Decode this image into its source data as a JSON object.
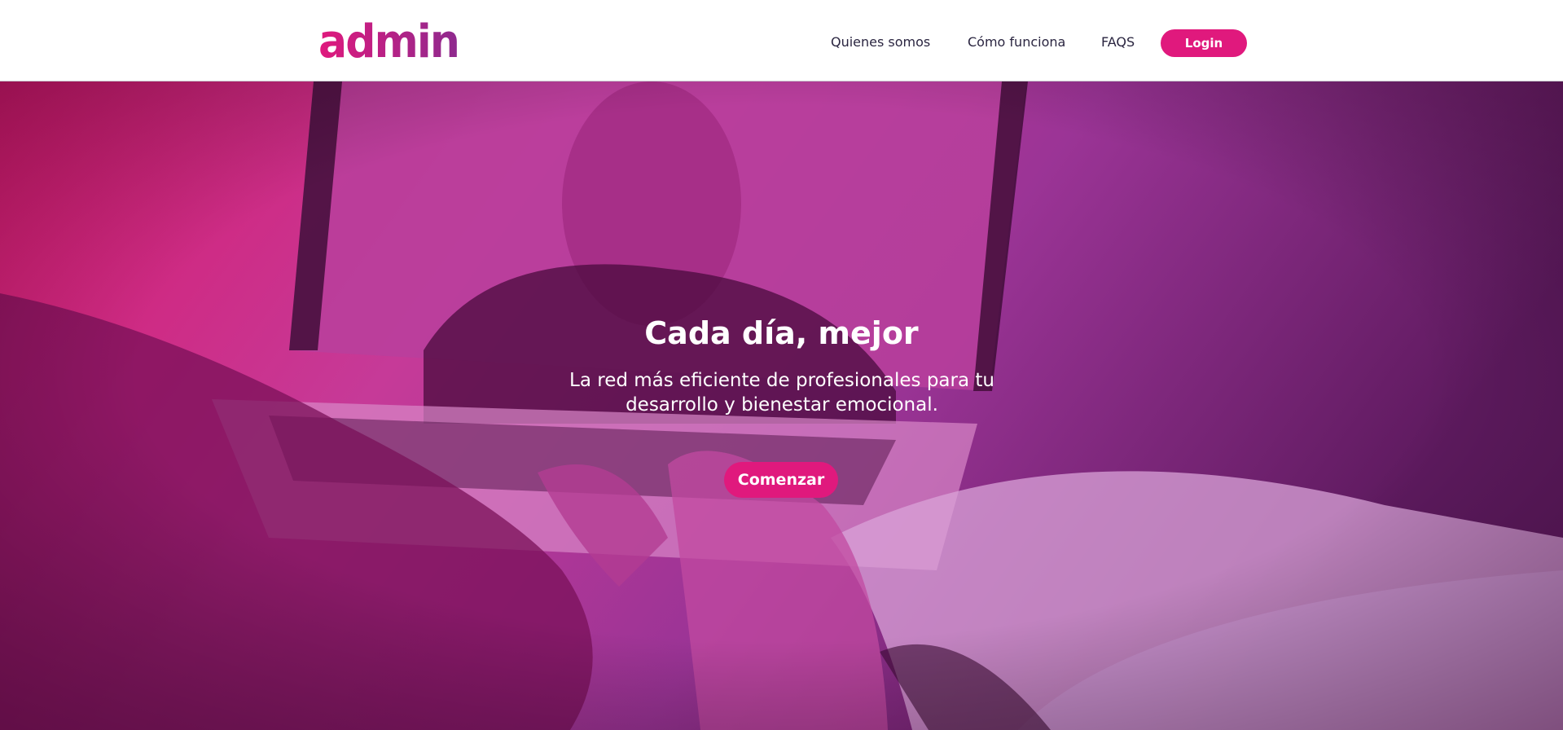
{
  "colors": {
    "brand_pink": "#e0197d",
    "brand_purple": "#8e2a8e",
    "nav_text": "#2a2540",
    "hero_overlay_left": "#d81a6e",
    "hero_overlay_right": "#6a1d6c"
  },
  "header": {
    "logo_text": "admin",
    "logo_icon": "admin-logo",
    "nav": [
      {
        "label": "Quienes somos"
      },
      {
        "label": "Cómo funciona"
      },
      {
        "label": "FAQS"
      }
    ],
    "login_label": "Login"
  },
  "hero": {
    "title": "Cada día, mejor",
    "subtitle": "La red más eficiente de profesionales para tu desarrollo y bienestar emocional.",
    "cta_label": "Comenzar"
  }
}
